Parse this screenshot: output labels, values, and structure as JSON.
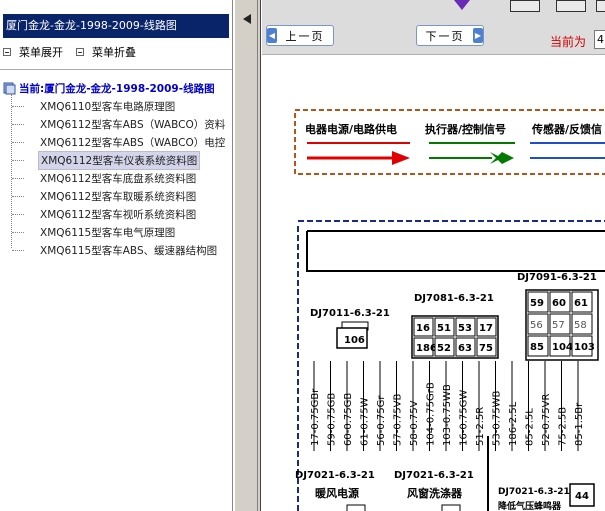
{
  "left": {
    "title": "厦门金龙-金龙-1998-2009-线路图",
    "expand_label": "菜单展开",
    "collapse_label": "菜单折叠",
    "root_label": "当前:厦门金龙-金龙-1998-2009-线路图",
    "items": [
      "XMQ6110型客车电路原理图",
      "XMQ6112型客车ABS（WABCO）资料",
      "XMQ6112型客车ABS（WABCO）电控",
      "XMQ6112型客车仪表系统资料图",
      "XMQ6112型客车底盘系统资料图",
      "XMQ6112型客车取暖系统资料图",
      "XMQ6112型客车视听系统资料图",
      "XMQ6115型客车电气原理图",
      "XMQ6115型客车ABS、缓速器结构图"
    ],
    "selected_index": 3
  },
  "toolbar": {
    "prev_label": "上一页",
    "next_label": "下一页",
    "current_page_label": "当前为",
    "page_value": "4"
  },
  "diagram": {
    "legend": [
      "电器电源/电路供电",
      "执行器/控制信号",
      "传感器/反馈信"
    ],
    "legend_colors": [
      "#e00000",
      "#007a00",
      "#1e4fc8"
    ],
    "connectors": {
      "dj7011": "DJ7011-6.3-21",
      "dj7011_pin": "106",
      "dj7081": "DJ7081-6.3-21",
      "dj7081_pins": [
        "16",
        "51",
        "53",
        "17",
        "186",
        "52",
        "63",
        "75"
      ],
      "dj7091": "DJ7091-6.3-21",
      "dj7091_pins": [
        "59",
        "60",
        "61",
        "56",
        "57",
        "58",
        "85",
        "104",
        "103"
      ]
    },
    "wires": [
      "17-0.75GBr",
      "59-0.75GB",
      "60-0.75GB",
      "61-0.75W",
      "56-0.75Gr",
      "57-0.75VB",
      "58-0.75V",
      "104-0.75GrB",
      "103-0.75WB",
      "16-0.75GW",
      "51-2.5R",
      "53-0.75WB",
      "186-2.5L",
      "85-2.5L",
      "52-0.75VR",
      "75-2.5B",
      "85-1.5Br"
    ],
    "bottom_labels": {
      "dj7021_a": "DJ7021-6.3-21",
      "dj7021_b": "DJ7021-6.3-21",
      "dj7021_c": "DJ7021-6.3-21",
      "heater_power": "暖风电源",
      "washer": "风窗洗涤器",
      "buzzer": "降低气压蜂鸣器",
      "pin44": "44"
    }
  }
}
